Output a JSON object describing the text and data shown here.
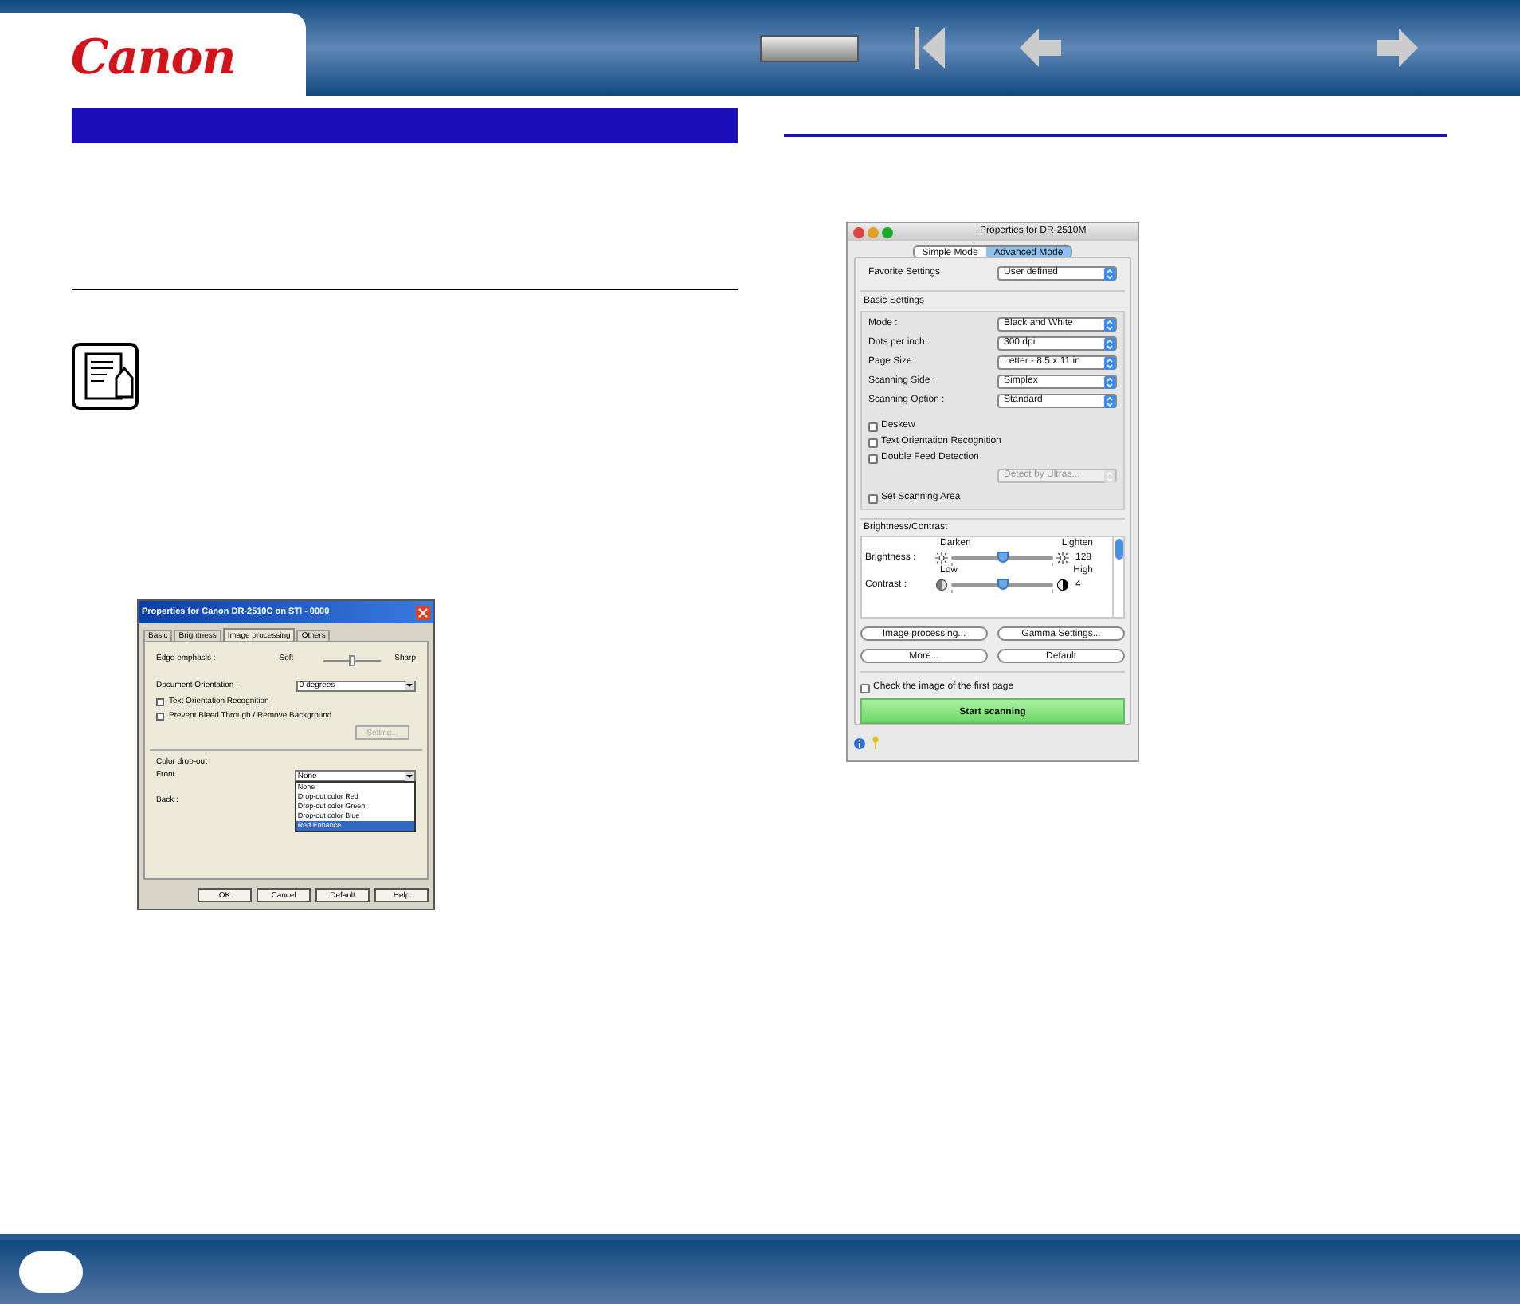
{
  "header": {
    "logo": "Canon",
    "nav": [
      {
        "kind": "blank"
      },
      {
        "kind": "first"
      },
      {
        "kind": "back"
      },
      {
        "kind": "forward"
      }
    ]
  },
  "windows_dialog": {
    "title": "Properties for Canon DR-2510C on STI - 0000",
    "tabs": [
      {
        "label": "Basic",
        "selected": false
      },
      {
        "label": "Brightness",
        "selected": false
      },
      {
        "label": "Image processing",
        "selected": true
      },
      {
        "label": "Others",
        "selected": false
      }
    ],
    "edge_emphasis": {
      "label": "Edge emphasis :",
      "min": "Soft",
      "max": "Sharp",
      "level": 0.5
    },
    "orientation": {
      "label": "Document Orientation :",
      "value": "0 degrees"
    },
    "checkboxes": [
      {
        "label": "Text Orientation Recognition",
        "checked": false
      },
      {
        "label": "Prevent Bleed Through / Remove Background",
        "checked": false
      }
    ],
    "setting_button": {
      "label": "Setting...",
      "disabled": true
    },
    "color_dropout": {
      "title": "Color drop-out",
      "front_label": "Front :",
      "front_value": "None",
      "back_label": "Back :",
      "options": [
        {
          "label": "None",
          "selected": false
        },
        {
          "label": "Drop-out color Red",
          "selected": false
        },
        {
          "label": "Drop-out color Green",
          "selected": false
        },
        {
          "label": "Drop-out color Blue",
          "selected": false
        },
        {
          "label": "Red Enhance",
          "selected": true
        }
      ]
    },
    "buttons": [
      "OK",
      "Cancel",
      "Default",
      "Help"
    ]
  },
  "mac_dialog": {
    "title": "Properties for DR-2510M",
    "modes": [
      {
        "label": "Simple Mode",
        "selected": false
      },
      {
        "label": "Advanced Mode",
        "selected": true
      }
    ],
    "favorite": {
      "label": "Favorite Settings",
      "value": "User defined"
    },
    "basic_title": "Basic Settings",
    "settings": [
      {
        "label": "Mode :",
        "value": "Black and White"
      },
      {
        "label": "Dots per inch :",
        "value": "300 dpi"
      },
      {
        "label": "Page Size :",
        "value": "Letter - 8.5 x 11 in"
      },
      {
        "label": "Scanning Side :",
        "value": "Simplex"
      },
      {
        "label": "Scanning Option :",
        "value": "Standard"
      }
    ],
    "checkboxes": [
      {
        "label": "Deskew",
        "checked": false
      },
      {
        "label": "Text Orientation Recognition",
        "checked": false
      },
      {
        "label": "Double Feed Detection",
        "checked": false
      }
    ],
    "detect": {
      "value": "Detect by Ultras...",
      "disabled": true
    },
    "set_area": {
      "label": "Set Scanning Area",
      "checked": false
    },
    "bc_title": "Brightness/Contrast",
    "sliders": [
      {
        "kind": "brightness",
        "label": "Brightness :",
        "min": "Darken",
        "max": "Lighten",
        "reading": "128",
        "level": 0.5
      },
      {
        "kind": "contrast",
        "label": "Contrast :",
        "min": "Low",
        "max": "High",
        "reading": "4",
        "level": 0.5
      }
    ],
    "buttons": [
      "Image processing...",
      "Gamma Settings...",
      "More...",
      "Default"
    ],
    "first_page": {
      "label": "Check the image of the first page",
      "checked": false
    },
    "start": "Start scanning"
  }
}
